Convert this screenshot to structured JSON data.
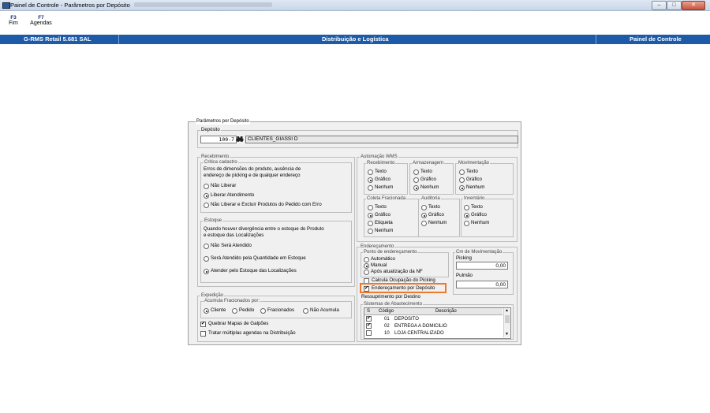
{
  "window": {
    "title": "Painel de Controle - Parâmetros por Depósito",
    "controls": [
      "–",
      "□",
      "✕"
    ]
  },
  "shortcuts": [
    {
      "key": "F3",
      "label": "Fim"
    },
    {
      "key": "F7",
      "label": "Agendas"
    }
  ],
  "header": {
    "left": "G-RMS Retail 5.681 SAL",
    "center": "Distribuição e Logística",
    "right": "Painel de Controle"
  },
  "dialog": {
    "title": "Parâmetros por Depósito",
    "deposito": {
      "label": "Depósito",
      "code": "100-7",
      "name": "CLIENTES_GIASSI D"
    },
    "recebimento": {
      "title": "Recebimento",
      "critica": {
        "title": "Critica cadastro",
        "desc1": "Erros de dimensões do produto, ausência de",
        "desc2": "endereço de picking e de qualquer endereço",
        "options": [
          "Não Liberar",
          "Liberar Atendimento",
          "Não Liberar e Excluir Produtos do Pedido com Erro"
        ],
        "selected": 1
      },
      "estoque": {
        "title": "Estoque",
        "desc1": "Quando houver divergência entre o estoque do Produto",
        "desc2": "e estoque das Localizações",
        "options": [
          "Não Será Atendido",
          "Será Atendido pela Quantidade em Estoque",
          "Atender pelo Estoque das Localizações"
        ],
        "selected": 2
      }
    },
    "expedicao": {
      "title": "Expedição",
      "acumula": {
        "title": "Acumula Fracionados por:",
        "options": [
          "Cliente",
          "Pedido",
          "Fracionados",
          "Não Acumula"
        ],
        "selected": 0
      },
      "quebrar": {
        "label": "Quebrar Mapas de Galpões",
        "checked": true
      },
      "tratar": {
        "label": "Tratar múltiplas agendas na Distribuição",
        "checked": false
      }
    },
    "automacao": {
      "title": "Automação WMS",
      "recebimento": {
        "title": "Recebimento",
        "options": [
          "Texto",
          "Gráfico",
          "Nenhum"
        ],
        "selected": 1
      },
      "armazenagem": {
        "title": "Armazenagem",
        "options": [
          "Texto",
          "Gráfico",
          "Nenhum"
        ],
        "selected": 2
      },
      "movimentacao": {
        "title": "Movimentação",
        "options": [
          "Texto",
          "Gráfico",
          "Nenhum"
        ],
        "selected": 2
      },
      "coleta": {
        "title": "Coleta Fracionada",
        "options": [
          "Texto",
          "Gráfico",
          "Etiqueta",
          "Nenhum"
        ],
        "selected": 1
      },
      "auditoria": {
        "title": "Auditoria",
        "options": [
          "Texto",
          "Gráfico",
          "Nenhum"
        ],
        "selected": 1
      },
      "inventario": {
        "title": "Inventário",
        "options": [
          "Texto",
          "Gráfico",
          "Nenhum"
        ],
        "selected": 1
      }
    },
    "enderecamento": {
      "title": "Endereçamento",
      "ponto": {
        "title": "Ponto de endereçamento",
        "options": [
          "Automático",
          "Manual",
          "Após atualização da NF"
        ],
        "selected": 1
      },
      "calcula": {
        "label": "Calcula Ocupação do Picking",
        "checked": false
      },
      "por_deposito": {
        "label": "Endereçamento por Depósito",
        "checked": true
      },
      "ressuprimento": {
        "label": "Ressuprimento por Destino"
      },
      "cm": {
        "title": "Cm de Movimentação",
        "picking_label": "Picking",
        "picking_value": "0,00",
        "pulmao_label": "Pulmão",
        "pulmao_value": "0,00"
      },
      "sistemas": {
        "title": "Sistemas de Abastecimento",
        "columns": [
          "S",
          "Código",
          "Descrição"
        ],
        "rows": [
          {
            "checked": true,
            "code": "01",
            "desc": "DEPOSITO"
          },
          {
            "checked": true,
            "code": "02",
            "desc": "ENTREGA A DOMICILIO"
          },
          {
            "checked": false,
            "code": "10",
            "desc": "LOJA CENTRALIZADO"
          }
        ]
      }
    },
    "highlight_color": "#f0782a"
  }
}
